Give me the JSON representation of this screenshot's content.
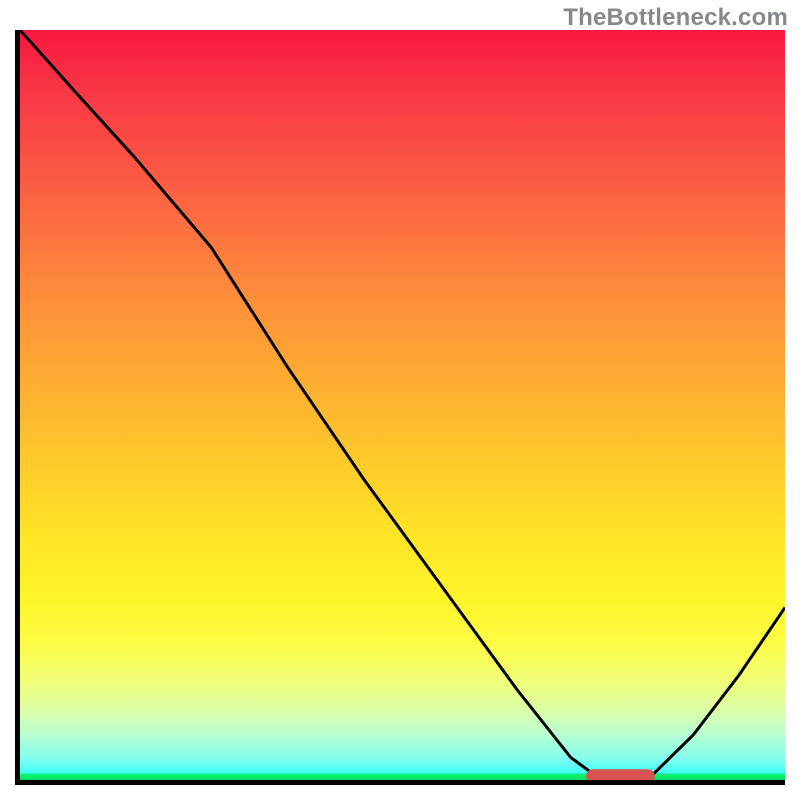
{
  "watermark": "TheBottleneck.com",
  "chart_data": {
    "type": "line",
    "title": "",
    "xlabel": "",
    "ylabel": "",
    "xlim": [
      0,
      100
    ],
    "ylim": [
      0,
      100
    ],
    "grid": false,
    "series": [
      {
        "name": "curve",
        "x": [
          0,
          7,
          15,
          25,
          35,
          45,
          55,
          65,
          72,
          76,
          82,
          88,
          94,
          100
        ],
        "y": [
          100,
          92,
          83,
          71,
          55,
          40,
          26,
          12,
          3,
          0,
          0,
          6,
          14,
          23
        ]
      }
    ],
    "marker": {
      "shape": "rounded-bar",
      "x_start": 74,
      "x_end": 83,
      "y": 0.5,
      "color": "#d9544f"
    },
    "background_gradient": {
      "stops": [
        {
          "pos": 0.0,
          "color": "#f8183f"
        },
        {
          "pos": 0.2,
          "color": "#fb5b44"
        },
        {
          "pos": 0.46,
          "color": "#feab33"
        },
        {
          "pos": 0.76,
          "color": "#fef52a"
        },
        {
          "pos": 0.94,
          "color": "#b7fed2"
        },
        {
          "pos": 1.0,
          "color": "#07e161"
        }
      ]
    }
  }
}
